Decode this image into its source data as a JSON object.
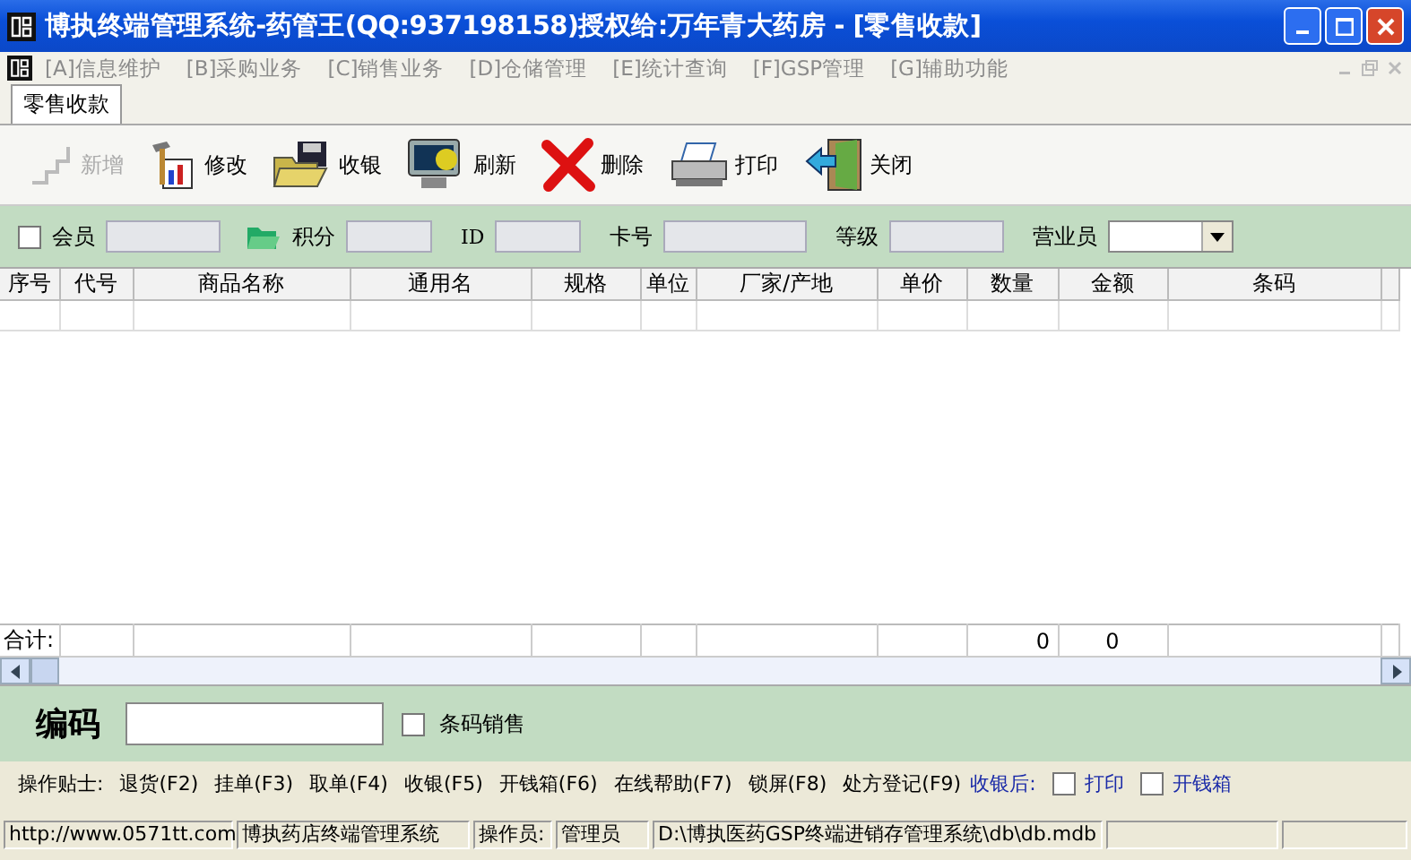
{
  "window": {
    "title": "博执终端管理系统-药管王(QQ:937198158)授权给:万年青大药房 - [零售收款]"
  },
  "menu": [
    {
      "label": "[A]信息维护"
    },
    {
      "label": "[B]采购业务"
    },
    {
      "label": "[C]销售业务"
    },
    {
      "label": "[D]仓储管理"
    },
    {
      "label": "[E]统计查询"
    },
    {
      "label": "[F]GSP管理"
    },
    {
      "label": "[G]辅助功能"
    }
  ],
  "tabs": [
    {
      "label": "零售收款",
      "selected": true
    }
  ],
  "toolbar": [
    {
      "label": "新增",
      "disabled": true
    },
    {
      "label": "修改",
      "disabled": false
    },
    {
      "label": "收银",
      "disabled": false
    },
    {
      "label": "刷新",
      "disabled": false
    },
    {
      "label": "删除",
      "disabled": false
    },
    {
      "label": "打印",
      "disabled": false
    },
    {
      "label": "关闭",
      "disabled": false
    }
  ],
  "member": {
    "member_label": "会员",
    "member_checked": false,
    "points_label": "积分",
    "id_label": "ID",
    "card_label": "卡号",
    "level_label": "等级",
    "salesperson_label": "营业员"
  },
  "table": {
    "columns": [
      "序号",
      "代号",
      "商品名称",
      "通用名",
      "规格",
      "单位",
      "厂家/产地",
      "单价",
      "数量",
      "金额",
      "条码"
    ],
    "total": {
      "label": "合计:",
      "quantity": "0",
      "amount": "0"
    }
  },
  "barcode": {
    "label": "编码",
    "option_label": "条码销售",
    "option_checked": false
  },
  "tips": {
    "label": "操作贴士:",
    "items": [
      "退货(F2)",
      "挂单(F3)",
      "取单(F4)",
      "收银(F5)",
      "开钱箱(F6)",
      "在线帮助(F7)",
      "锁屏(F8)",
      "处方登记(F9)"
    ],
    "after_label": "收银后:",
    "after_options": [
      {
        "label": "打印",
        "checked": false
      },
      {
        "label": "开钱箱",
        "checked": false
      }
    ]
  },
  "status_bar": [
    "http://www.0571tt.com",
    "博执药店终端管理系统",
    "操作员:",
    "管理员",
    "D:\\博执医药GSP终端进销存管理系统\\db\\db.mdb"
  ]
}
